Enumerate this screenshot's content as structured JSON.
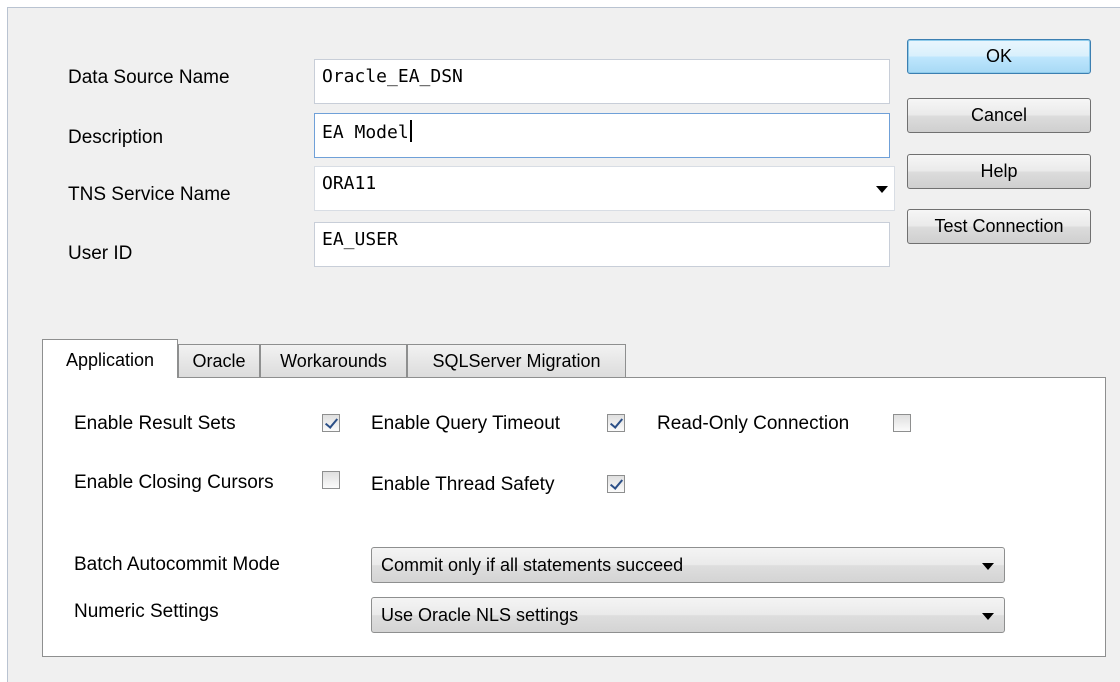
{
  "form": {
    "data_source_name": {
      "label": "Data Source Name",
      "value": "Oracle_EA_DSN"
    },
    "description": {
      "label": "Description",
      "value": "EA Model"
    },
    "tns_service_name": {
      "label": "TNS Service Name",
      "value": "ORA11"
    },
    "user_id": {
      "label": "User ID",
      "value": "EA_USER"
    }
  },
  "buttons": {
    "ok": "OK",
    "cancel": "Cancel",
    "help": "Help",
    "test_connection": "Test Connection"
  },
  "tabs": [
    {
      "label": "Application",
      "active": true
    },
    {
      "label": "Oracle",
      "active": false
    },
    {
      "label": "Workarounds",
      "active": false
    },
    {
      "label": "SQLServer Migration",
      "active": false
    }
  ],
  "application": {
    "options": [
      {
        "label": "Enable Result Sets",
        "checked": true
      },
      {
        "label": "Enable Query Timeout",
        "checked": true
      },
      {
        "label": "Read-Only Connection",
        "checked": false
      },
      {
        "label": "Enable Closing Cursors",
        "checked": false
      },
      {
        "label": "Enable Thread Safety",
        "checked": true
      }
    ],
    "batch_autocommit": {
      "label": "Batch Autocommit Mode",
      "value": "Commit only if all statements succeed"
    },
    "numeric_settings": {
      "label": "Numeric Settings",
      "value": "Use Oracle NLS settings"
    }
  },
  "icons": {
    "dropdown": "chevron-down-icon",
    "checkbox_checked": "checkmark-icon"
  }
}
